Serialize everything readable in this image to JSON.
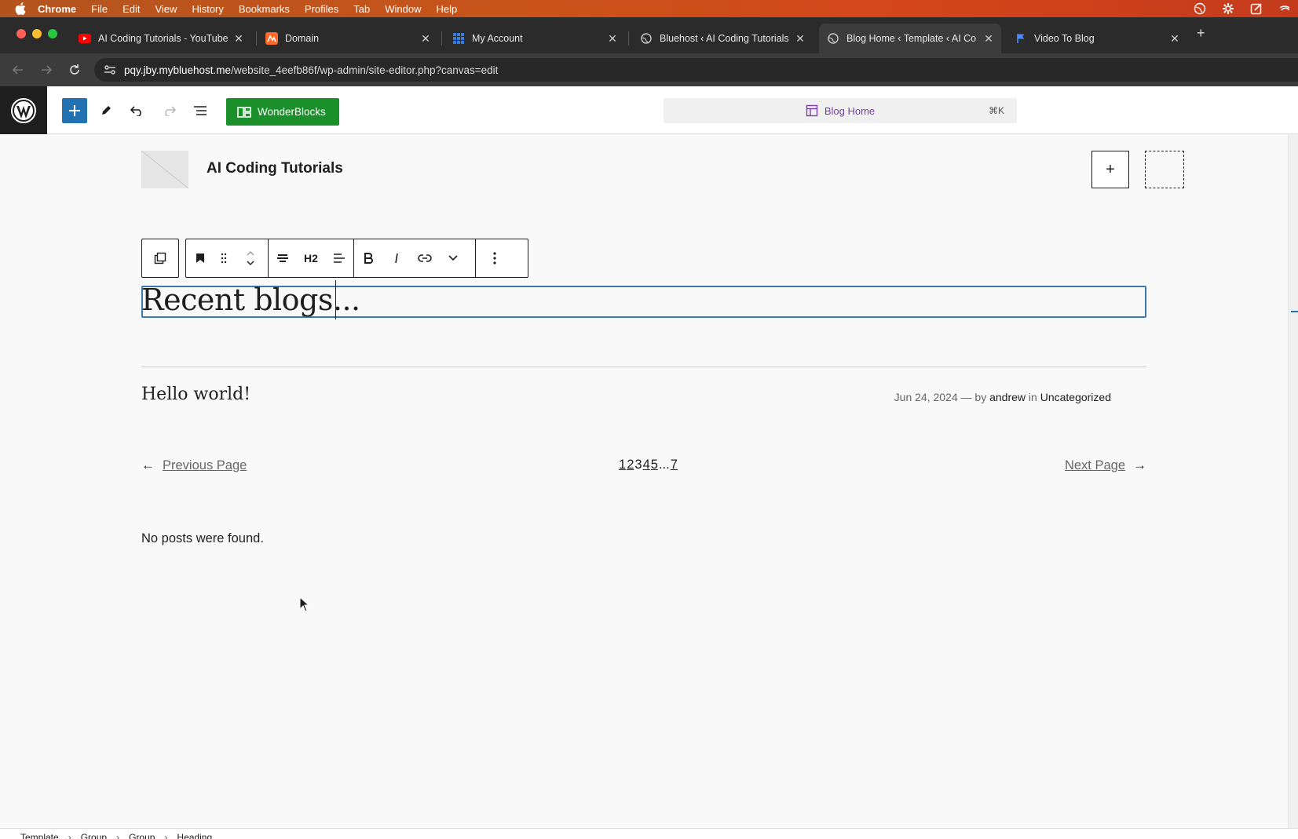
{
  "menubar": {
    "items": [
      "Chrome",
      "File",
      "Edit",
      "View",
      "History",
      "Bookmarks",
      "Profiles",
      "Tab",
      "Window",
      "Help"
    ]
  },
  "tabs": [
    {
      "title": "AI Coding Tutorials - YouTube",
      "icon": "youtube-icon"
    },
    {
      "title": "Domain",
      "icon": "domain-icon"
    },
    {
      "title": "My Account",
      "icon": "grid-icon"
    },
    {
      "title": "Bluehost ‹ AI Coding Tutorials",
      "icon": "globe-icon"
    },
    {
      "title": "Blog Home ‹ Template ‹ AI Co",
      "icon": "globe-icon",
      "active": true
    },
    {
      "title": "Video To Blog",
      "icon": "flag-icon"
    }
  ],
  "address": {
    "url_host": "pqy.jby.mybluehost.me",
    "url_path": "/website_4eefb86f/wp-admin/site-editor.php?canvas=edit"
  },
  "toolbar": {
    "wonderblocks_label": "WonderBlocks",
    "command_label": "Blog Home",
    "command_shortcut": "⌘K"
  },
  "site": {
    "title": "AI Coding Tutorials"
  },
  "block_toolbar": {
    "heading_level": "H2"
  },
  "content": {
    "heading": "Recent blogs...",
    "post_title": "Hello world!",
    "post_date": "Jun 24, 2024",
    "post_by": "— by",
    "post_author": "andrew",
    "post_in": "in",
    "post_category": "Uncategorized",
    "prev_label": "Previous Page",
    "next_label": "Next Page",
    "pages": [
      "1",
      "2",
      "3",
      "4",
      "5",
      "...",
      "7"
    ],
    "no_posts": "No posts were found."
  },
  "breadcrumb": [
    "Template",
    "Group",
    "Group",
    "Heading"
  ],
  "colors": {
    "wp_blue": "#2271b1",
    "wonder_green": "#1a8f2a",
    "command_purple": "#7a3fa8"
  }
}
